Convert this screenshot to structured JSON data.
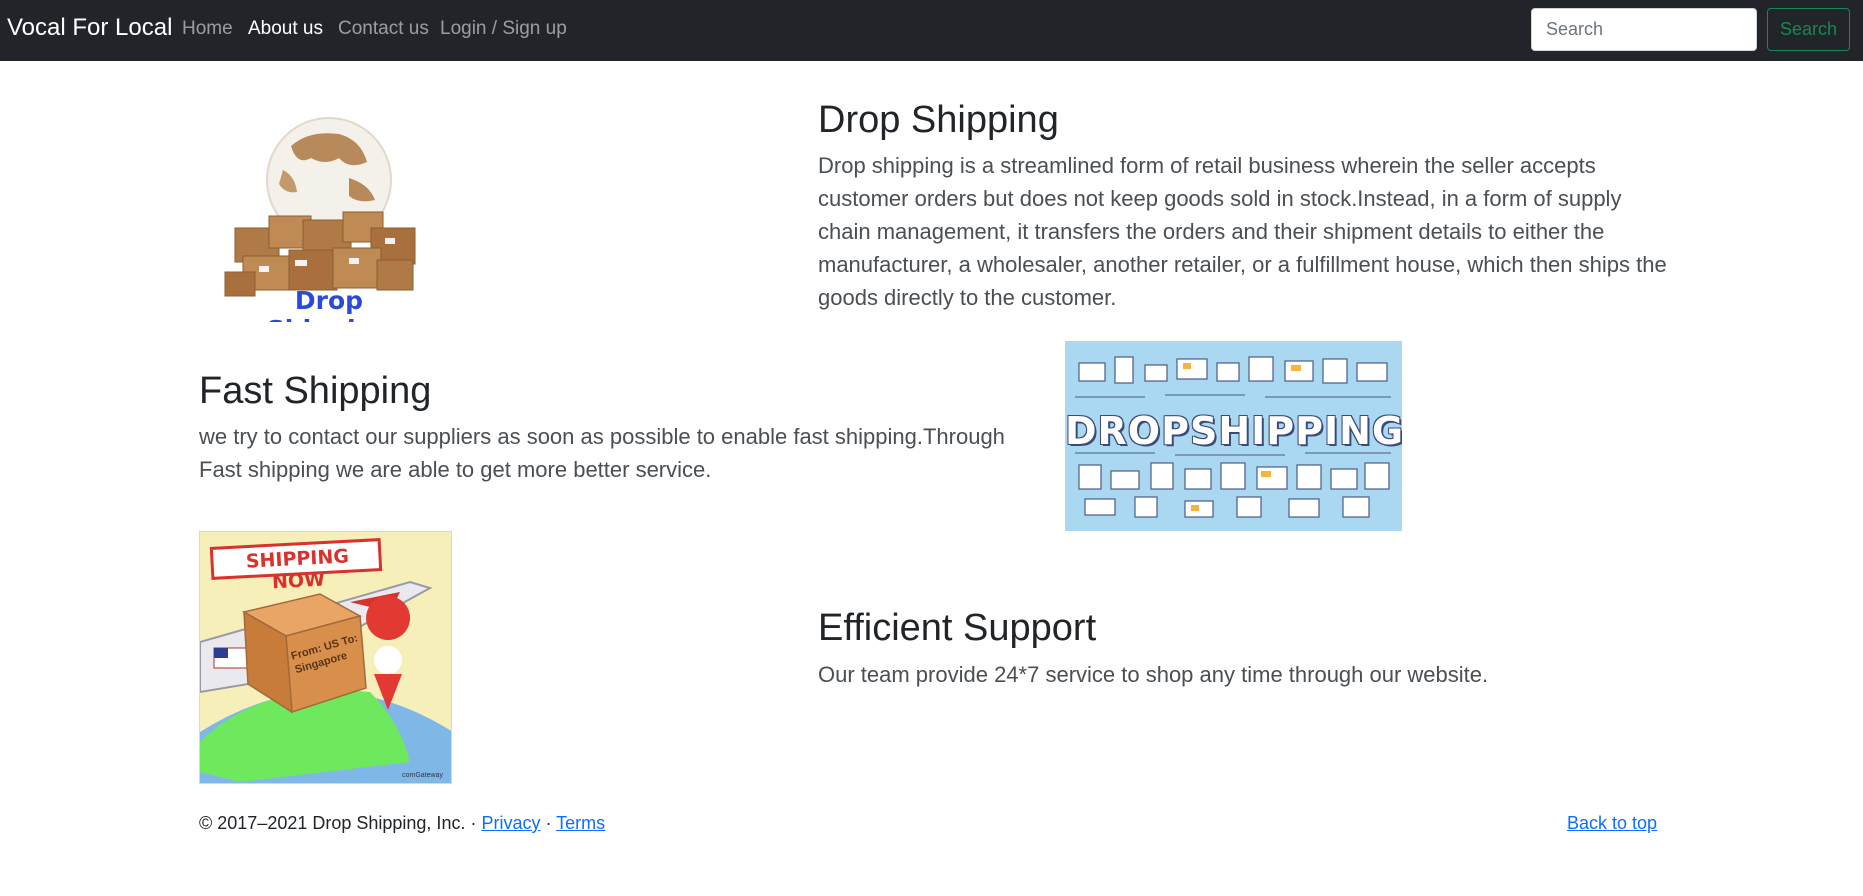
{
  "navbar": {
    "brand": "Vocal For Local",
    "links": [
      "Home",
      "About us",
      "Contact us",
      "Login / Sign up"
    ],
    "active_index": 1,
    "search_placeholder": "Search",
    "search_button": "Search"
  },
  "sections": [
    {
      "title": "Drop Shipping",
      "text": "Drop shipping is a streamlined form of retail business wherein the seller accepts customer orders but does not keep goods sold in stock.Instead, in a form of supply chain management, it transfers the orders and their shipment details to either the manufacturer, a wholesaler, another retailer, or a fulfillment house, which then ships the goods directly to the customer.",
      "image_caption": "Drop Shipping"
    },
    {
      "title": "Fast Shipping",
      "text": "we try to contact our suppliers as soon as possible to enable fast shipping.Through Fast shipping we are able to get more better service.",
      "image_caption": "DROPSHIPPING"
    },
    {
      "title": "Efficient Support",
      "text": "Our team provide 24*7 service to shop any time through our website.",
      "image_badge": "SHIPPING NOW",
      "image_box_text": "From: US To: Singapore",
      "image_credit": "comGateway"
    }
  ],
  "footer": {
    "copyright": "© 2017–2021 Drop Shipping, Inc. · ",
    "privacy": "Privacy",
    "sep": " · ",
    "terms": "Terms",
    "back_to_top": "Back to top"
  },
  "colors": {
    "navbar_bg": "#212529",
    "link_blue": "#0d6efd",
    "success_green": "#198754"
  }
}
